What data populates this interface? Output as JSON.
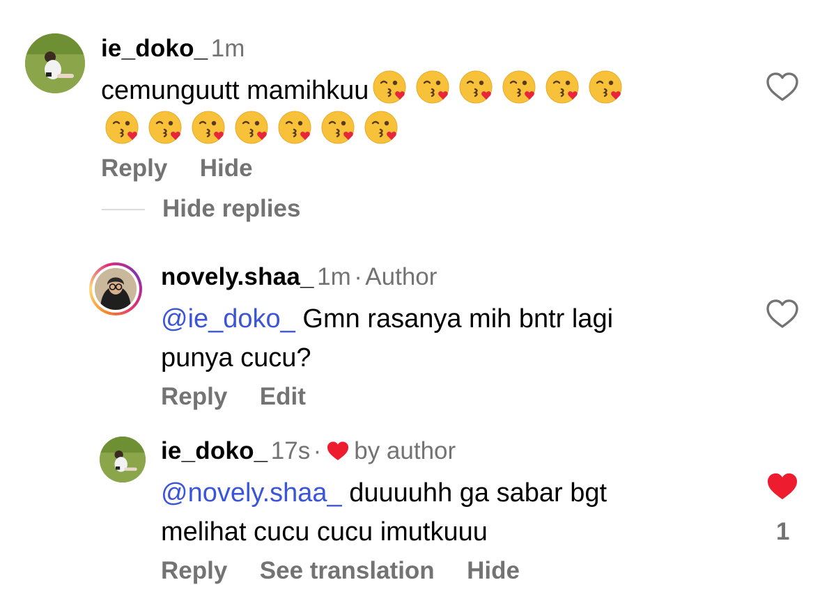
{
  "comment1": {
    "username": "ie_doko_",
    "time": "1m",
    "text": "cemunguutt mamihkuu",
    "emoji_count": 13,
    "emoji_icon": "face-blowing-a-kiss-icon",
    "actions": [
      "Reply",
      "Hide"
    ],
    "hide_replies": "Hide replies"
  },
  "reply1": {
    "username": "novely.shaa_",
    "time": "1m",
    "separator": "·",
    "author_badge": "Author",
    "mention": "@ie_doko_",
    "text_line1": " Gmn rasanya mih bntr lagi",
    "text_line2": "punya cucu?",
    "actions": [
      "Reply",
      "Edit"
    ]
  },
  "reply2": {
    "username": "ie_doko_",
    "time": "17s",
    "separator": "·",
    "liked_by": "by author",
    "mention": "@novely.shaa_",
    "text_line1": " duuuuhh ga sabar bgt",
    "text_line2": "melihat cucu cucu imutkuuu",
    "like_count": "1",
    "actions": [
      "Reply",
      "See translation",
      "Hide"
    ]
  },
  "colors": {
    "mention": "#3b55d9",
    "meta": "#737373",
    "heart_red": "#ed1c2e"
  }
}
